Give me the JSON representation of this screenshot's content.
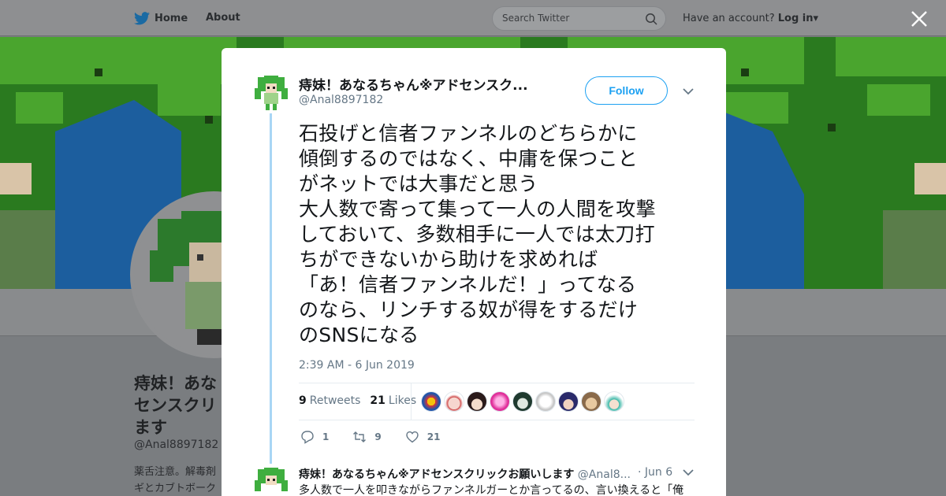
{
  "topbar": {
    "home_label": "Home",
    "about_label": "About",
    "search_placeholder": "Search Twitter",
    "account_prompt": "Have an account?",
    "login_label": "Log in"
  },
  "background_profile": {
    "name": "痔妹！あな　セ​ンスクリ　ます",
    "name_lines": [
      "痔妹！あな",
      "センスクリ",
      "ます"
    ],
    "handle": "@Anal8897182",
    "bio_lines": [
      "薬舌注意。解毒剤",
      "ギとカブトボーク"
    ]
  },
  "tweet": {
    "display_name": "痔妹！あなるちゃん※アドセンスク...",
    "handle": "@Anal8897182",
    "follow_label": "Follow",
    "text": "石投げと信者ファンネルのどちらかに\n傾倒するのではなく、中庸を保つこと\nがネットでは大事だと思う\n大人数で寄って集って一人の人間を攻撃\nしておいて、多数相手に一人では太刀打\nちができないから助けを求めれば\n「あ！信者ファンネルだ！」ってなる\nのなら、リンチする奴が得をするだけ\nのSNSになる",
    "timestamp": "2:39 AM - 6 Jun 2019",
    "retweets_count": "9",
    "retweets_label": "Retweets",
    "likes_count": "21",
    "likes_label": "Likes",
    "reply_count": "1",
    "retweet_count_action": "9",
    "like_count_action": "21"
  },
  "reply": {
    "display_name": "痔妹！あなるちゃん※アドセンスクリックお願いします",
    "handle": "@Anal8...",
    "date": "· Jun 6",
    "text": "多人数で一人を叩きながらファンネルガーとか言ってるの、言い換えると「俺"
  },
  "colors": {
    "accent": "#1da1f2",
    "thread_line": "#a8d6f5",
    "muted_text": "#657786",
    "overlay": "#7a7d80"
  },
  "icons": [
    "twitter-bird-icon",
    "search-icon",
    "close-icon",
    "chevron-down-icon",
    "reply-icon",
    "retweet-icon",
    "heart-icon"
  ]
}
